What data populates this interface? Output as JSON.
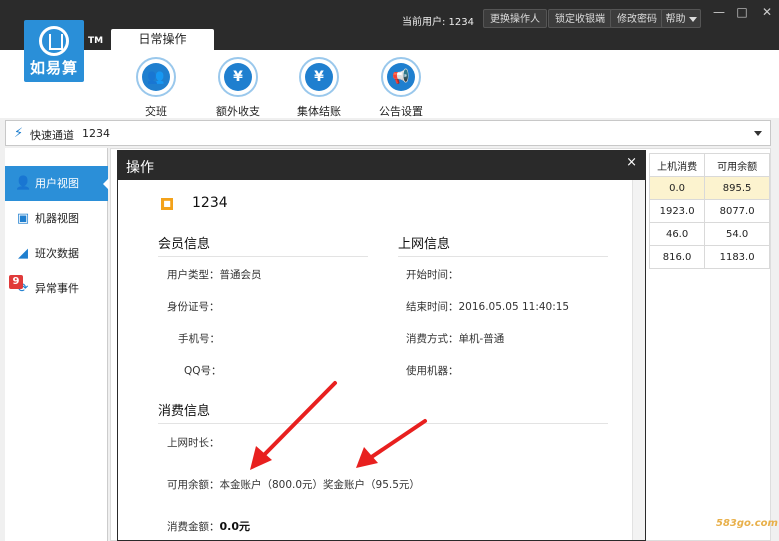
{
  "app": {
    "logo_text": "如易算",
    "trademark": "TM",
    "current_user_label": "当前用户: 1234",
    "buttons": {
      "change_operator": "更换操作人",
      "lock": "锁定收银端",
      "change_password": "修改密码",
      "help": "帮助"
    },
    "window": {
      "minimize": "—",
      "maximize": "□",
      "close": "✕"
    }
  },
  "tabs": {
    "daily": "日常操作"
  },
  "toolbar": {
    "shift": {
      "label": "交班",
      "icon": "user-group-icon"
    },
    "extra": {
      "label": "额外收支",
      "icon": "yen-coin-icon"
    },
    "group": {
      "label": "集体结账",
      "icon": "cash-register-icon"
    },
    "notice": {
      "label": "公告设置",
      "icon": "megaphone-icon"
    }
  },
  "quick": {
    "label": "快速通道",
    "value": "1234"
  },
  "sidebar": {
    "items": [
      {
        "label": "用户视图",
        "icon": "user-icon"
      },
      {
        "label": "机器视图",
        "icon": "monitor-icon"
      },
      {
        "label": "班次数据",
        "icon": "chart-icon"
      },
      {
        "label": "异常事件",
        "icon": "warning-icon",
        "badge": "9"
      }
    ]
  },
  "table": {
    "headers": [
      "上机消费",
      "可用余额"
    ],
    "rows": [
      [
        "0.0",
        "895.5"
      ],
      [
        "1923.0",
        "8077.0"
      ],
      [
        "46.0",
        "54.0"
      ],
      [
        "816.0",
        "1183.0"
      ]
    ]
  },
  "modal": {
    "title": "操作",
    "close": "×",
    "account": "1234",
    "sections": {
      "member": "会员信息",
      "online": "上网信息",
      "consume": "消费信息"
    },
    "member": {
      "type": "用户类型：普通会员",
      "id_card": "身份证号：",
      "phone": "手机号：",
      "qq": "QQ号："
    },
    "online": {
      "start": "开始时间：",
      "end": "结束时间：2016.05.05 11:40:15",
      "mode": "消费方式：单机-普通",
      "machine": "使用机器："
    },
    "consume": {
      "duration": "上网时长：",
      "balance": "可用余额：本金账户（800.0元）奖金账户（95.5元）",
      "amount_label": "消费金额：",
      "amount_value": "0.0元"
    }
  },
  "watermark": "583go.com",
  "colors": {
    "accent": "#2b8fd8",
    "header": "#2b2b2b",
    "arrow": "#e8201f",
    "badge": "#e03a3a"
  }
}
